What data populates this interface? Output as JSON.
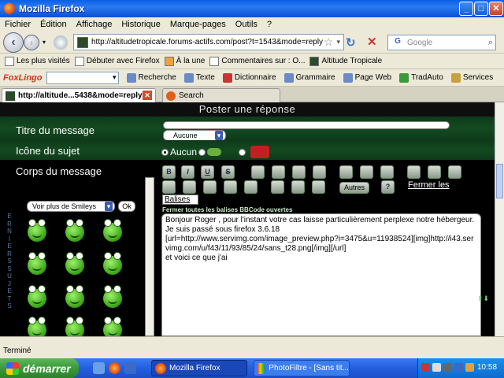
{
  "window": {
    "title": "Mozilla Firefox"
  },
  "menu": [
    "Fichier",
    "Édition",
    "Affichage",
    "Historique",
    "Marque-pages",
    "Outils",
    "?"
  ],
  "nav": {
    "url": "http://altitudetropicale.forums-actifs.com/post?t=1543&mode=reply",
    "search_placeholder": "Google",
    "search_engine": "G"
  },
  "bookmarks": [
    "Les plus visités",
    "Débuter avec Firefox",
    "À la une",
    "Commentaires sur : O...",
    "Altitude Tropicale"
  ],
  "foxlingo": {
    "logo": "FoxLingo",
    "items": [
      "Recherche",
      "Texte",
      "Dictionnaire",
      "Grammaire",
      "Page Web",
      "TradAuto",
      "Services"
    ]
  },
  "tabs": [
    {
      "label": "http://altitude...5438&mode=reply"
    },
    {
      "label": "Search"
    }
  ],
  "page": {
    "header": "Poster une réponse",
    "title_label": "Titre du message",
    "icon_label": "Icône du sujet",
    "icon_select": "Aucune",
    "icon_none": "Aucun",
    "body_label": "Corps du message",
    "smileys_select": "Voir plus de Smileys",
    "ok": "Ok",
    "left_letters": [
      "E",
      "R",
      "N",
      "I",
      "E",
      "R",
      "S",
      "",
      "S",
      "U",
      "J",
      "E",
      "T",
      "S"
    ],
    "toolbar_row1": [
      "B",
      "I",
      "U",
      "S",
      "",
      "",
      "",
      "",
      "",
      "",
      "",
      "",
      "",
      "",
      ""
    ],
    "autres": "Autres",
    "help": "?",
    "close_tags": "Fermer les",
    "balises": "Balises",
    "close_all": "Fermer toutes les balises BBCode ouvertes",
    "message_lines": [
      "Bonjour Roger , pour l'instant votre cas laisse particulièrement perplexe notre hébergeur.",
      "Je suis passé sous firefox 3.6.18",
      "[url=http://www.servimg.com/image_preview.php?i=3475&u=11938524][img]http://i43.servimg.com/u/f43/11/93/85/24/sans_t28.png[/img][/url]",
      "et voici ce que j'ai"
    ]
  },
  "status": "Terminé",
  "taskbar": {
    "start": "démarrer",
    "tasks": [
      "Mozilla Firefox",
      "PhotoFiltre - [Sans tit..."
    ],
    "clock": "10:58"
  }
}
